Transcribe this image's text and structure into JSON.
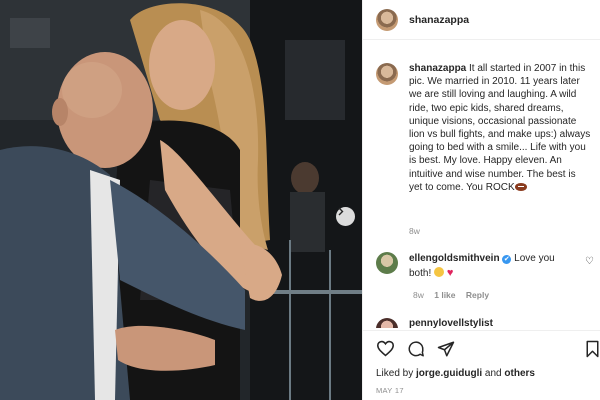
{
  "post": {
    "username": "shanazappa",
    "caption_username": "shanazappa",
    "caption_text": "It all started in 2007 in this pic. We married in 2010. 11 years later we are still loving and laughing. A wild ride, two epic kids, shared dreams, unique visions, occasional passionate lion vs bull fights, and make ups:) always going to bed with a smile... Life with you is best. My love. Happy eleven. An intuitive and wise number. The best is yet to come. You ROCK",
    "caption_emoji": "football",
    "time_ago": "8w"
  },
  "comments": [
    {
      "username": "ellengoldsmithvein",
      "verified": "✔",
      "text": "Love you both!",
      "time_ago": "8w",
      "likes": "1 like",
      "reply": "Reply"
    },
    {
      "username": "pennylovellstylist"
    }
  ],
  "footer": {
    "liked_prefix": "Liked by",
    "liked_user": "jorge.guidugli",
    "liked_and": "and",
    "liked_others": "others",
    "date": "MAY 17"
  },
  "icons": {
    "heart": "heart-icon",
    "comment": "comment-icon",
    "share": "share-icon",
    "save": "bookmark-icon",
    "next": "chevron-right-icon"
  },
  "colors": {
    "text": "#262626",
    "secondary": "#8e8e8e",
    "verified": "#3897f0",
    "heart": "#e0245e"
  }
}
